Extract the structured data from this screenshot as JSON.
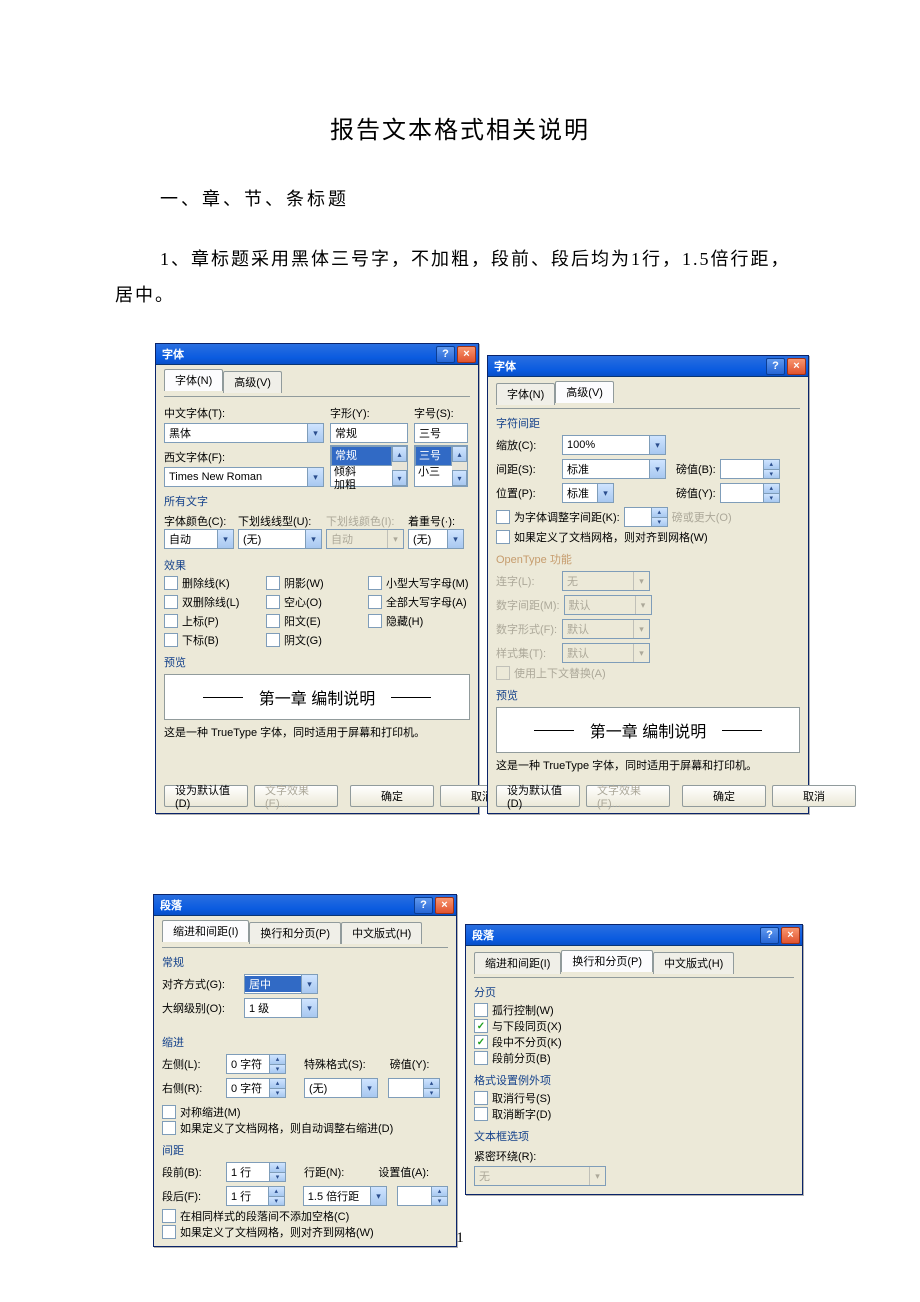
{
  "doc": {
    "title": "报告文本格式相关说明",
    "section1": "一、章、节、条标题",
    "para1_a": "1、章标题采用黑体三号字，不加粗，段前、段后均为1行，1.5倍行距，",
    "para1_b": "居中。",
    "page_num": "1"
  },
  "font_dlg": {
    "title": "字体",
    "tab_font": "字体(N)",
    "tab_adv": "高级(V)",
    "lbl_cn_font": "中文字体(T):",
    "cn_font": "黑体",
    "lbl_en_font": "西文字体(F):",
    "en_font": "Times New Roman",
    "lbl_style": "字形(Y):",
    "style_opts": [
      "常规",
      "倾斜",
      "加粗"
    ],
    "lbl_size": "字号(S):",
    "size_val": "三号",
    "size_opts": [
      "三号",
      "小三"
    ],
    "grp_all": "所有文字",
    "lbl_color": "字体颜色(C):",
    "color": "自动",
    "lbl_under": "下划线线型(U):",
    "under": "(无)",
    "lbl_ucolor": "下划线颜色(I):",
    "ucolor": "自动",
    "lbl_emph": "着重号(·):",
    "emph": "(无)",
    "grp_eff": "效果",
    "eff": {
      "strike": "删除线(K)",
      "dstrike": "双删除线(L)",
      "sup": "上标(P)",
      "sub": "下标(B)",
      "shadow": "阴影(W)",
      "outline": "空心(O)",
      "emboss": "阳文(E)",
      "engrave": "阴文(G)",
      "smcaps": "小型大写字母(M)",
      "allcaps": "全部大写字母(A)",
      "hidden": "隐藏(H)"
    },
    "grp_prev": "预览",
    "prev_text": "第一章 编制说明",
    "prev_note": "这是一种 TrueType 字体，同时适用于屏幕和打印机。",
    "btn_default": "设为默认值(D)",
    "btn_texteff": "文字效果(E)...",
    "btn_ok": "确定",
    "btn_cancel": "取消"
  },
  "font_adv": {
    "title": "字体",
    "tab_font": "字体(N)",
    "tab_adv": "高级(V)",
    "grp_spacing": "字符间距",
    "lbl_scale": "缩放(C):",
    "scale": "100%",
    "lbl_spacing": "间距(S):",
    "spacing": "标准",
    "lbl_spval": "磅值(B):",
    "lbl_pos": "位置(P):",
    "pos": "标准",
    "lbl_posval": "磅值(Y):",
    "chk_kern": "为字体调整字间距(K):",
    "kern_unit": "磅或更大(O)",
    "chk_grid": "如果定义了文档网格，则对齐到网格(W)",
    "grp_ot": "OpenType 功能",
    "lbl_lig": "连字(L):",
    "lig": "无",
    "lbl_nspc": "数字间距(M):",
    "nspc": "默认",
    "lbl_nform": "数字形式(F):",
    "nform": "默认",
    "lbl_sset": "样式集(T):",
    "sset": "默认",
    "chk_ctx": "使用上下文替换(A)",
    "grp_prev": "预览",
    "prev_text": "第一章 编制说明",
    "prev_note": "这是一种 TrueType 字体，同时适用于屏幕和打印机。",
    "btn_default": "设为默认值(D)",
    "btn_texteff": "文字效果(E)...",
    "btn_ok": "确定",
    "btn_cancel": "取消"
  },
  "para_dlg": {
    "title": "段落",
    "tab1": "缩进和间距(I)",
    "tab2": "换行和分页(P)",
    "tab3": "中文版式(H)",
    "grp_gen": "常规",
    "lbl_align": "对齐方式(G):",
    "align": "居中",
    "lbl_out": "大纲级别(O):",
    "out": "1 级",
    "grp_indent": "缩进",
    "lbl_left": "左侧(L):",
    "left": "0 字符",
    "lbl_right": "右侧(R):",
    "right": "0 字符",
    "lbl_spec": "特殊格式(S):",
    "spec": "(无)",
    "lbl_specv": "磅值(Y):",
    "chk_mirror": "对称缩进(M)",
    "chk_autoind": "如果定义了文档网格，则自动调整右缩进(D)",
    "grp_space": "间距",
    "lbl_before": "段前(B):",
    "before": "1 行",
    "lbl_after": "段后(F):",
    "after": "1 行",
    "lbl_line": "行距(N):",
    "line": "1.5 倍行距",
    "lbl_at": "设置值(A):",
    "chk_nospace": "在相同样式的段落间不添加空格(C)",
    "chk_gridsnap": "如果定义了文档网格，则对齐到网格(W)"
  },
  "para_dlg2": {
    "title": "段落",
    "tab1": "缩进和间距(I)",
    "tab2": "换行和分页(P)",
    "tab3": "中文版式(H)",
    "grp_page": "分页",
    "chk_widow": "孤行控制(W)",
    "chk_keepnext": "与下段同页(X)",
    "chk_keeptog": "段中不分页(K)",
    "chk_pgbreak": "段前分页(B)",
    "grp_fmtexc": "格式设置例外项",
    "chk_suppln": "取消行号(S)",
    "chk_nohyph": "取消断字(D)",
    "grp_txtbox": "文本框选项",
    "lbl_tight": "紧密环绕(R):",
    "tight": "无"
  }
}
